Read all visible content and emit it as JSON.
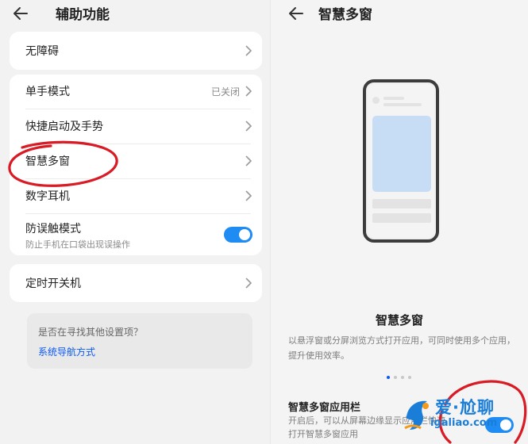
{
  "colors": {
    "accent": "#0a59f7",
    "toggle_on": "#1f8cf4",
    "annotation_red": "#d81b24",
    "watermark_blue": "#1a7dd8",
    "watermark_orange": "#f39a1b"
  },
  "left": {
    "header": {
      "back_icon": "arrow-left-icon",
      "title": "辅助功能"
    },
    "items": [
      {
        "label": "无障碍",
        "value": "",
        "icon": "chevron-right-icon"
      },
      {
        "label": "单手模式",
        "value": "已关闭",
        "icon": "chevron-right-icon"
      },
      {
        "label": "快捷启动及手势",
        "value": "",
        "icon": "chevron-right-icon"
      },
      {
        "label": "智慧多窗",
        "value": "",
        "icon": "chevron-right-icon"
      },
      {
        "label": "数字耳机",
        "value": "",
        "icon": "chevron-right-icon"
      },
      {
        "label": "防误触模式",
        "sublabel": "防止手机在口袋出现误操作",
        "toggle_on": true
      },
      {
        "label": "定时开关机",
        "value": "",
        "icon": "chevron-right-icon"
      }
    ],
    "hint": {
      "question": "是否在寻找其他设置项？",
      "link": "系统导航方式"
    }
  },
  "right": {
    "header": {
      "back_icon": "arrow-left-icon",
      "title": "智慧多窗"
    },
    "feature": {
      "title": "智慧多窗",
      "description": "以悬浮窗或分屏浏览方式打开应用，可同时使用多个应用，提升使用效率。",
      "page_dots": 4,
      "active_dot": 0
    },
    "sub_setting": {
      "title": "智慧多窗应用栏",
      "description": "开启后，可以从屏幕边缘显示应用栏快速打开智慧多窗应用",
      "toggle_on": true
    }
  },
  "watermark": {
    "cn": "爱·尬聊",
    "en": "igaliao.com"
  }
}
